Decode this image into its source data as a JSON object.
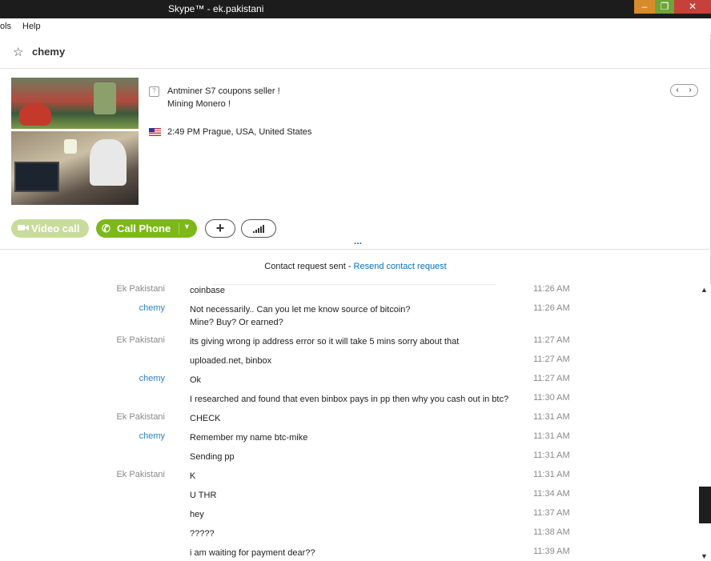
{
  "window": {
    "title": "Skype™ - ek.pakistani",
    "min": "–",
    "max": "❐",
    "close": "✕"
  },
  "menu": {
    "tools": "ols",
    "help": "Help"
  },
  "contact": {
    "name": "chemy",
    "mood_line1": "Antminer S7 coupons seller !",
    "mood_line2": "Mining Monero !",
    "location": "2:49 PM Prague, USA, United States"
  },
  "buttons": {
    "video_call": "Video call",
    "call_phone": "Call Phone",
    "add": "+"
  },
  "divider_dots": "...",
  "request": {
    "text": "Contact request sent - ",
    "link": "Resend contact request"
  },
  "messages": [
    {
      "sender": "Ek Pakistani",
      "text": "coinbase",
      "time": "11:26 AM"
    },
    {
      "sender": "chemy",
      "text": "Not necessarily.. Can you let me know source of bitcoin?",
      "text2": "Mine? Buy? Or earned?",
      "time": "11:26 AM"
    },
    {
      "sender": "Ek Pakistani",
      "text": "its giving wrong ip address error so it will take 5 mins sorry about that",
      "time": "11:27 AM"
    },
    {
      "sender": "",
      "text": "uploaded.net, binbox",
      "time": "11:27 AM"
    },
    {
      "sender": "chemy",
      "text": "Ok",
      "time": "11:27 AM"
    },
    {
      "sender": "",
      "text": "I researched and found that even binbox pays in pp then why you cash out in btc?",
      "time": "11:30 AM"
    },
    {
      "sender": "Ek Pakistani",
      "text": "CHECK",
      "time": "11:31 AM"
    },
    {
      "sender": "chemy",
      "text": "Remember my name btc-mike",
      "time": "11:31 AM"
    },
    {
      "sender": "",
      "text": "Sending pp",
      "time": "11:31 AM"
    },
    {
      "sender": "Ek Pakistani",
      "text": "K",
      "time": "11:31 AM"
    },
    {
      "sender": "",
      "text": "U THR",
      "time": "11:34 AM"
    },
    {
      "sender": "",
      "text": "hey",
      "time": "11:37 AM"
    },
    {
      "sender": "",
      "text": "?????",
      "time": "11:38 AM"
    },
    {
      "sender": "",
      "text": "i am waiting for payment dear??",
      "time": "11:39 AM"
    }
  ]
}
